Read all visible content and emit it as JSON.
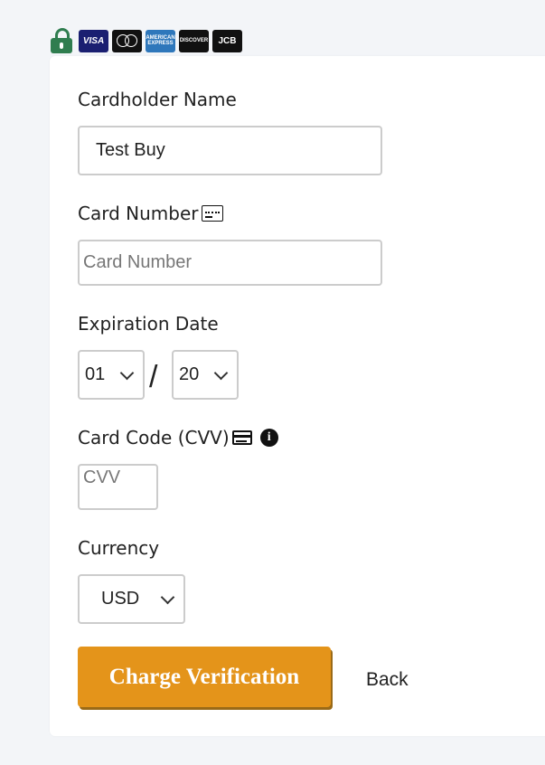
{
  "cards": {
    "visa": "VISA",
    "amex": "AMERICAN EXPRESS",
    "discover": "DISCOVER",
    "jcb": "JCB"
  },
  "form": {
    "cardholder_label": "Cardholder Name",
    "cardholder_value": "Test Buy",
    "card_number_label": "Card Number",
    "card_number_placeholder": "Card Number",
    "expiration_label": "Expiration Date",
    "exp_month": "01",
    "exp_separator": "/",
    "exp_year": "20",
    "cvv_label": "Card Code (CVV)",
    "cvv_placeholder": "CVV",
    "info_glyph": "i",
    "currency_label": "Currency",
    "currency_value": "USD"
  },
  "actions": {
    "charge_label": "Charge Verification",
    "back_label": "Back"
  },
  "colors": {
    "accent": "#e4941a",
    "lock": "#2f7d4f",
    "visa": "#1a1f71",
    "amex": "#2e77bb"
  }
}
